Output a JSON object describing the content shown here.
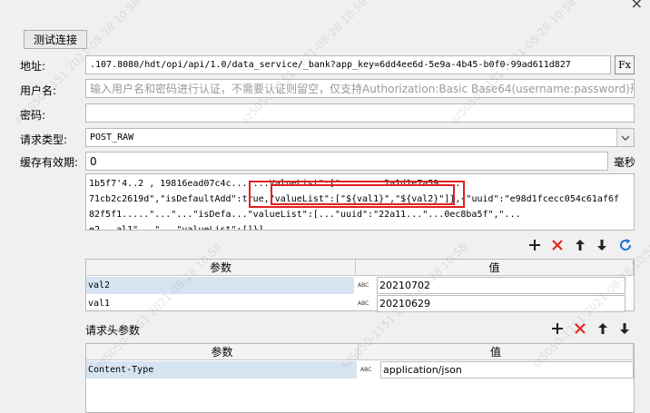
{
  "window": {
    "close_glyph": "×"
  },
  "buttons": {
    "test_connection": "测试连接",
    "fx": "Fx"
  },
  "form": {
    "address_label": "地址:",
    "address_value": ".107.8080/hdt/opi/api/1.0/data_service/_bank?app_key=6dd4ee6d-5e9a-4b45-b0f0-99ad611d827",
    "username_label": "用户名:",
    "username_placeholder": "输入用户名和密码进行认证，不需要认证则留空，仅支持Authorization:Basic Base64(username:password)形式",
    "password_label": "密码:",
    "password_value": "",
    "request_type_label": "请求类型:",
    "request_type_value": "POST_RAW",
    "cache_label": "缓存有效期:",
    "cache_value": "0",
    "cache_unit": "毫秒"
  },
  "body_text": {
    "line1": "1b5f7'4..2 , 19816ead07c4c...  ...ValueList\":[\"   ...      ...2a1d1e7a59    ...",
    "line2_a": "71cb2c2619d\",\"isDefaultAdd\":true,",
    "line2_b": "\"valueList\":[\"${val1}\",\"${val2}\"]}",
    "line2_c": ",{\"uuid\":\"e98d1fcecc054c61af6f",
    "line3": "82f5f1.....\"...\"...\"isDefa...\"valueList\":[...\"uuid\":\"22a11...\"...0ec8ba5f\",\"...",
    "line4": "e2...al1\"...\"...\"valueList\":[]}]"
  },
  "toolbar_icons": [
    "plus-icon",
    "delete-icon",
    "arrow-up-icon",
    "arrow-down-icon",
    "refresh-icon"
  ],
  "params_table": {
    "col_param": "参数",
    "col_value": "值",
    "type_glyph": "ABC",
    "rows": [
      {
        "name": "val2",
        "value": "20210702"
      },
      {
        "name": "val1",
        "value": "20210629"
      }
    ]
  },
  "headers_section": {
    "title": "请求头参数"
  },
  "headers_table": {
    "col_param": "参数",
    "col_value": "值",
    "type_glyph": "ABC",
    "rows": [
      {
        "name": "Content-Type",
        "value": "application/json"
      }
    ]
  },
  "watermark": "sz5050-1151 2021-08-28 10:58"
}
